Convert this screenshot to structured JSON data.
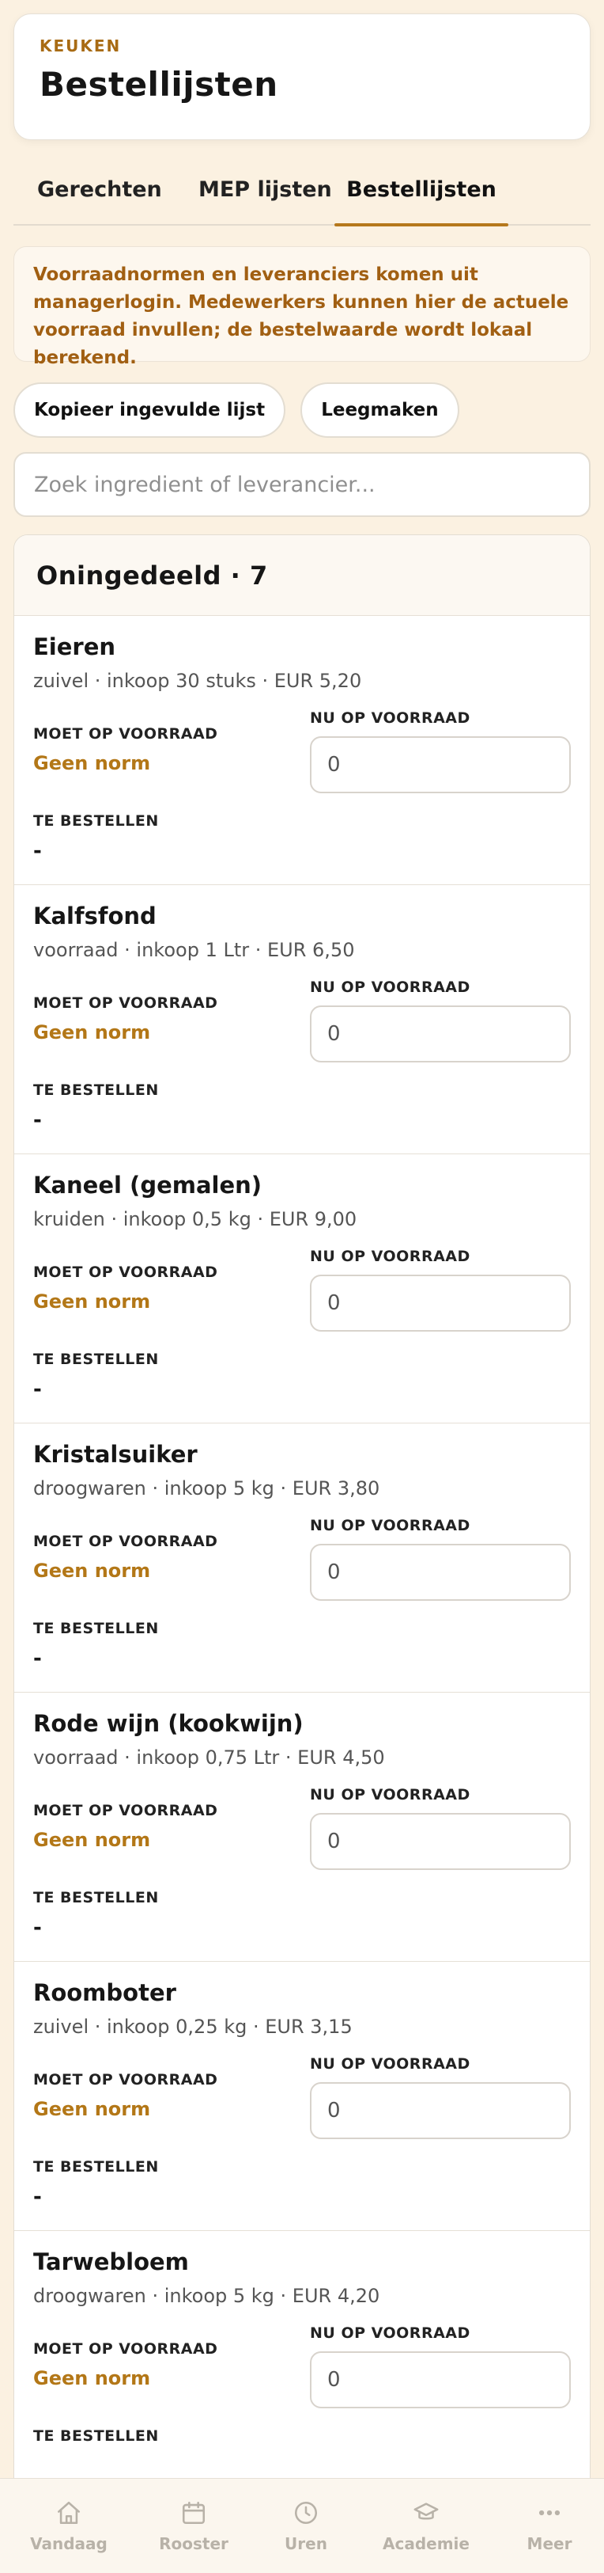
{
  "header": {
    "eyebrow": "KEUKEN",
    "title": "Bestellijsten"
  },
  "tabs": [
    {
      "label": "Gerechten",
      "active": false
    },
    {
      "label": "MEP lijsten",
      "active": false
    },
    {
      "label": "Bestellijsten",
      "active": true
    }
  ],
  "notice": "Voorraadnormen en leveranciers komen uit managerlogin. Medewerkers kunnen hier de actuele voorraad invullen; de bestelwaarde wordt lokaal berekend.",
  "actions": {
    "copy_label": "Kopieer ingevulde lijst",
    "clear_label": "Leegmaken"
  },
  "search": {
    "placeholder": "Zoek ingredient of leverancier...",
    "value": ""
  },
  "group": {
    "title": "Oningedeeld · 7"
  },
  "labels": {
    "norm": "MOET OP VOORRAAD",
    "now": "NU OP VOORRAAD",
    "order": "TE BESTELLEN"
  },
  "items": [
    {
      "name": "Eieren",
      "meta": "zuivel · inkoop 30 stuks · EUR 5,20",
      "norm": "Geen norm",
      "stock": "0",
      "order": "-"
    },
    {
      "name": "Kalfsfond",
      "meta": "voorraad · inkoop 1 Ltr · EUR 6,50",
      "norm": "Geen norm",
      "stock": "0",
      "order": "-"
    },
    {
      "name": "Kaneel (gemalen)",
      "meta": "kruiden · inkoop 0,5 kg · EUR 9,00",
      "norm": "Geen norm",
      "stock": "0",
      "order": "-"
    },
    {
      "name": "Kristalsuiker",
      "meta": "droogwaren · inkoop 5 kg · EUR 3,80",
      "norm": "Geen norm",
      "stock": "0",
      "order": "-"
    },
    {
      "name": "Rode wijn (kookwijn)",
      "meta": "voorraad · inkoop 0,75 Ltr · EUR 4,50",
      "norm": "Geen norm",
      "stock": "0",
      "order": "-"
    },
    {
      "name": "Roomboter",
      "meta": "zuivel · inkoop 0,25 kg · EUR 3,15",
      "norm": "Geen norm",
      "stock": "0",
      "order": "-"
    },
    {
      "name": "Tarwebloem",
      "meta": "droogwaren · inkoop 5 kg · EUR 4,20",
      "norm": "Geen norm",
      "stock": "0",
      "order": ""
    }
  ],
  "nav": [
    {
      "label": "Vandaag",
      "icon": "home-icon"
    },
    {
      "label": "Rooster",
      "icon": "calendar-icon"
    },
    {
      "label": "Uren",
      "icon": "clock-icon"
    },
    {
      "label": "Academie",
      "icon": "graduation-cap-icon"
    },
    {
      "label": "Meer",
      "icon": "more-dots-icon"
    }
  ],
  "colors": {
    "accent": "#b5781c",
    "background": "#fbf1e1",
    "notice_text": "#a15f12",
    "nav_inactive": "#b8b2a8"
  }
}
